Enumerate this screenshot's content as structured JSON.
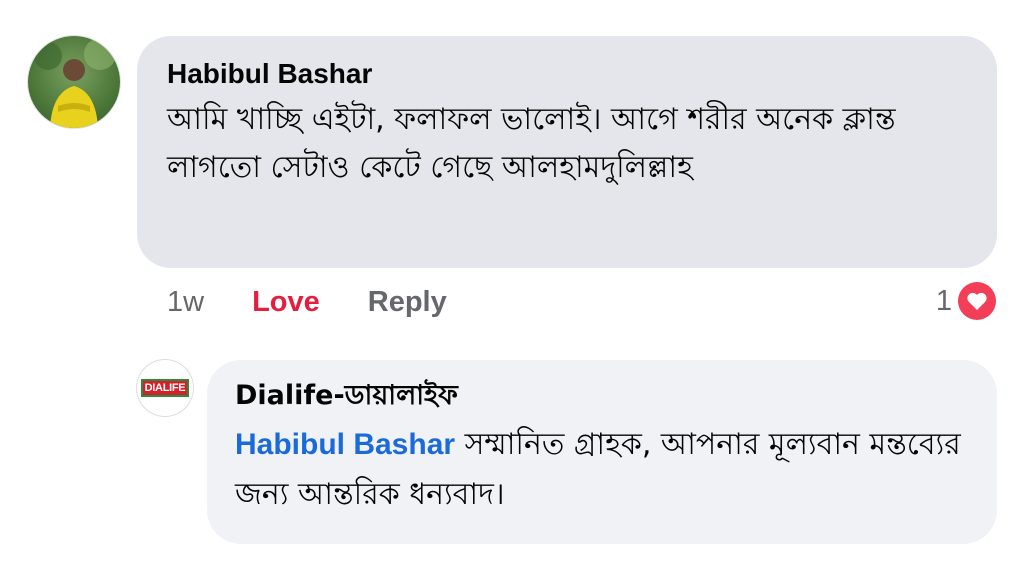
{
  "comment": {
    "author": "Habibul Bashar",
    "text": "আমি খাচ্ছি এইটা, ফলাফল ভালোই। আগে শরীর অনেক ক্লান্ত লাগতো সেটাও কেটে গেছে আলহামদুলিল্লাহ",
    "time": "1w",
    "love_label": "Love",
    "reply_label": "Reply",
    "reaction_count": "1",
    "reaction_icon": "heart-icon",
    "reaction_color": "#f33e58",
    "love_color": "#e41e3f"
  },
  "reply": {
    "author": "Dialife-ডায়ালাইফ",
    "logo_text": "DIALIFE",
    "mention": "Habibul Bashar",
    "text": " সম্মানিত গ্রাহক, আপনার মূল্যবান মন্তব্যের জন্য আন্তরিক ধন্যবাদ।",
    "mention_color": "#1b6ad9"
  }
}
